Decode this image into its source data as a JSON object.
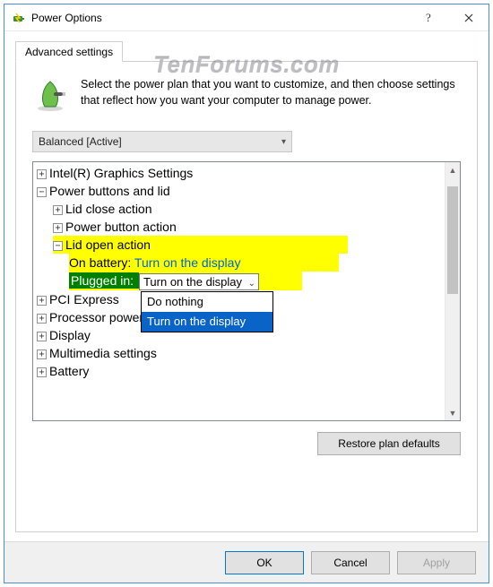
{
  "window": {
    "title": "Power Options"
  },
  "watermark": "TenForums.com",
  "tabs": {
    "advanced": "Advanced settings"
  },
  "intro": "Select the power plan that you want to customize, and then choose settings that reflect how you want your computer to manage power.",
  "plan_selected": "Balanced [Active]",
  "tree": {
    "graphics": "Intel(R) Graphics Settings",
    "pbl": "Power buttons and lid",
    "lid_close": "Lid close action",
    "pba": "Power button action",
    "lid_open": "Lid open action",
    "on_battery_label": "On battery: ",
    "on_battery_value": "Turn on the display",
    "plugged_in_label": "Plugged in: ",
    "plugged_in_value": "Turn on the display",
    "pci": "PCI Express",
    "ppm": "Processor power management",
    "display": "Display",
    "mm": "Multimedia settings",
    "battery": "Battery"
  },
  "dropdown": {
    "opt0": "Do nothing",
    "opt1": "Turn on the display"
  },
  "buttons": {
    "restore": "Restore plan defaults",
    "ok": "OK",
    "cancel": "Cancel",
    "apply": "Apply"
  }
}
